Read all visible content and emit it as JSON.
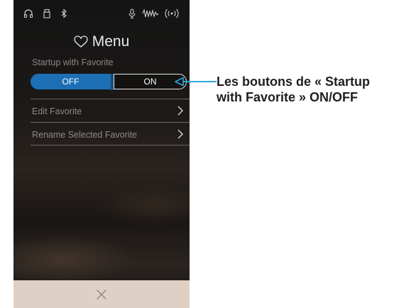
{
  "status_icons": [
    "headphones-icon",
    "usb-icon",
    "bluetooth-icon",
    "microphone-icon",
    "wave-icon",
    "wireless-icon"
  ],
  "menu": {
    "title": "Menu",
    "icon": "heart-icon"
  },
  "startup": {
    "label": "Startup with Favorite",
    "off_label": "OFF",
    "on_label": "ON",
    "selected": "OFF"
  },
  "rows": [
    {
      "label": "Edit Favorite",
      "icon": "chevron-right-icon"
    },
    {
      "label": "Rename Selected Favorite",
      "icon": "chevron-right-icon"
    }
  ],
  "footer": {
    "icon": "close-icon"
  },
  "callout": {
    "text": "Les boutons de « Startup with Favorite » ON/OFF"
  },
  "colors": {
    "accent": "#1d6fb5",
    "callout_arrow": "#2ea7e0",
    "footer_bg": "#ded0c4"
  }
}
